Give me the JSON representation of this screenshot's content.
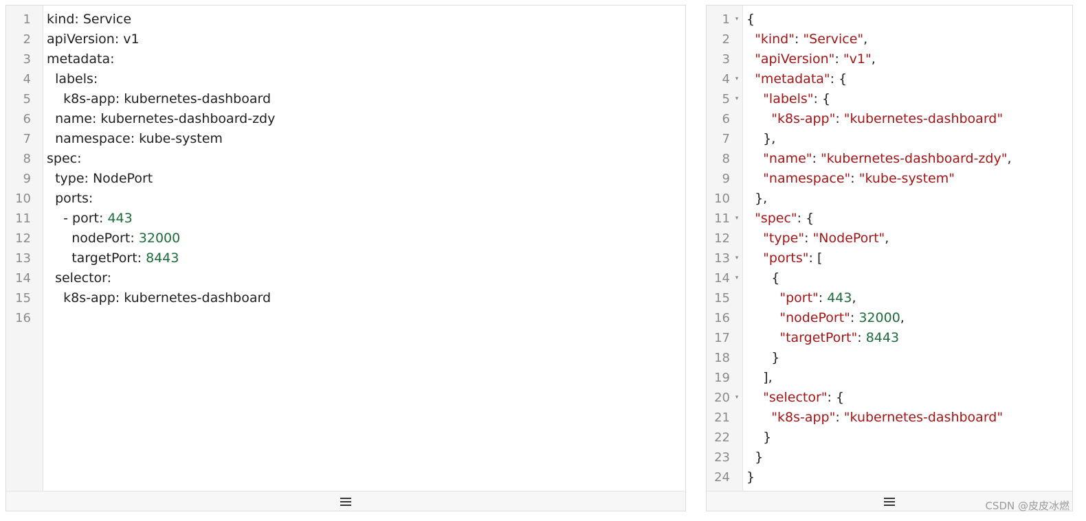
{
  "left_editor": {
    "lines": [
      {
        "n": "1",
        "tokens": [
          {
            "t": "kind: Service",
            "c": "p"
          }
        ]
      },
      {
        "n": "2",
        "tokens": [
          {
            "t": "apiVersion: v1",
            "c": "p"
          }
        ]
      },
      {
        "n": "3",
        "tokens": [
          {
            "t": "metadata:",
            "c": "p"
          }
        ]
      },
      {
        "n": "4",
        "tokens": [
          {
            "t": "  labels:",
            "c": "p"
          }
        ]
      },
      {
        "n": "5",
        "tokens": [
          {
            "t": "    k8s-app: kubernetes-dashboard",
            "c": "p"
          }
        ]
      },
      {
        "n": "6",
        "tokens": [
          {
            "t": "  name: kubernetes-dashboard-zdy",
            "c": "p"
          }
        ]
      },
      {
        "n": "7",
        "tokens": [
          {
            "t": "  namespace: kube-system",
            "c": "p"
          }
        ]
      },
      {
        "n": "8",
        "tokens": [
          {
            "t": "spec:",
            "c": "p"
          }
        ]
      },
      {
        "n": "9",
        "tokens": [
          {
            "t": "  type: NodePort",
            "c": "p"
          }
        ]
      },
      {
        "n": "10",
        "tokens": [
          {
            "t": "  ports:",
            "c": "p"
          }
        ]
      },
      {
        "n": "11",
        "tokens": [
          {
            "t": "    - port: ",
            "c": "p"
          },
          {
            "t": "443",
            "c": "n"
          }
        ]
      },
      {
        "n": "12",
        "tokens": [
          {
            "t": "      nodePort: ",
            "c": "p"
          },
          {
            "t": "32000",
            "c": "n"
          }
        ]
      },
      {
        "n": "13",
        "tokens": [
          {
            "t": "      targetPort: ",
            "c": "p"
          },
          {
            "t": "8443",
            "c": "n"
          }
        ]
      },
      {
        "n": "14",
        "tokens": [
          {
            "t": "  selector:",
            "c": "p"
          }
        ]
      },
      {
        "n": "15",
        "tokens": [
          {
            "t": "    k8s-app: kubernetes-dashboard",
            "c": "p"
          }
        ]
      },
      {
        "n": "16",
        "tokens": []
      }
    ],
    "footer_icon": "menu-icon"
  },
  "right_editor": {
    "lines": [
      {
        "n": "1",
        "fold": true,
        "tokens": [
          {
            "t": "{",
            "c": "p"
          }
        ]
      },
      {
        "n": "2",
        "tokens": [
          {
            "t": "  ",
            "c": "p"
          },
          {
            "t": "\"kind\"",
            "c": "k"
          },
          {
            "t": ": ",
            "c": "p"
          },
          {
            "t": "\"Service\"",
            "c": "s"
          },
          {
            "t": ",",
            "c": "p"
          }
        ]
      },
      {
        "n": "3",
        "tokens": [
          {
            "t": "  ",
            "c": "p"
          },
          {
            "t": "\"apiVersion\"",
            "c": "k"
          },
          {
            "t": ": ",
            "c": "p"
          },
          {
            "t": "\"v1\"",
            "c": "s"
          },
          {
            "t": ",",
            "c": "p"
          }
        ]
      },
      {
        "n": "4",
        "fold": true,
        "tokens": [
          {
            "t": "  ",
            "c": "p"
          },
          {
            "t": "\"metadata\"",
            "c": "k"
          },
          {
            "t": ": {",
            "c": "p"
          }
        ]
      },
      {
        "n": "5",
        "fold": true,
        "tokens": [
          {
            "t": "    ",
            "c": "p"
          },
          {
            "t": "\"labels\"",
            "c": "k"
          },
          {
            "t": ": {",
            "c": "p"
          }
        ]
      },
      {
        "n": "6",
        "tokens": [
          {
            "t": "      ",
            "c": "p"
          },
          {
            "t": "\"k8s-app\"",
            "c": "k"
          },
          {
            "t": ": ",
            "c": "p"
          },
          {
            "t": "\"kubernetes-dashboard\"",
            "c": "s"
          }
        ]
      },
      {
        "n": "7",
        "tokens": [
          {
            "t": "    },",
            "c": "p"
          }
        ]
      },
      {
        "n": "8",
        "tokens": [
          {
            "t": "    ",
            "c": "p"
          },
          {
            "t": "\"name\"",
            "c": "k"
          },
          {
            "t": ": ",
            "c": "p"
          },
          {
            "t": "\"kubernetes-dashboard-zdy\"",
            "c": "s"
          },
          {
            "t": ",",
            "c": "p"
          }
        ]
      },
      {
        "n": "9",
        "tokens": [
          {
            "t": "    ",
            "c": "p"
          },
          {
            "t": "\"namespace\"",
            "c": "k"
          },
          {
            "t": ": ",
            "c": "p"
          },
          {
            "t": "\"kube-system\"",
            "c": "s"
          }
        ]
      },
      {
        "n": "10",
        "tokens": [
          {
            "t": "  },",
            "c": "p"
          }
        ]
      },
      {
        "n": "11",
        "fold": true,
        "tokens": [
          {
            "t": "  ",
            "c": "p"
          },
          {
            "t": "\"spec\"",
            "c": "k"
          },
          {
            "t": ": {",
            "c": "p"
          }
        ]
      },
      {
        "n": "12",
        "tokens": [
          {
            "t": "    ",
            "c": "p"
          },
          {
            "t": "\"type\"",
            "c": "k"
          },
          {
            "t": ": ",
            "c": "p"
          },
          {
            "t": "\"NodePort\"",
            "c": "s"
          },
          {
            "t": ",",
            "c": "p"
          }
        ]
      },
      {
        "n": "13",
        "fold": true,
        "tokens": [
          {
            "t": "    ",
            "c": "p"
          },
          {
            "t": "\"ports\"",
            "c": "k"
          },
          {
            "t": ": [",
            "c": "p"
          }
        ]
      },
      {
        "n": "14",
        "fold": true,
        "tokens": [
          {
            "t": "      {",
            "c": "p"
          }
        ]
      },
      {
        "n": "15",
        "tokens": [
          {
            "t": "        ",
            "c": "p"
          },
          {
            "t": "\"port\"",
            "c": "k"
          },
          {
            "t": ": ",
            "c": "p"
          },
          {
            "t": "443",
            "c": "n"
          },
          {
            "t": ",",
            "c": "p"
          }
        ]
      },
      {
        "n": "16",
        "tokens": [
          {
            "t": "        ",
            "c": "p"
          },
          {
            "t": "\"nodePort\"",
            "c": "k"
          },
          {
            "t": ": ",
            "c": "p"
          },
          {
            "t": "32000",
            "c": "n"
          },
          {
            "t": ",",
            "c": "p"
          }
        ]
      },
      {
        "n": "17",
        "tokens": [
          {
            "t": "        ",
            "c": "p"
          },
          {
            "t": "\"targetPort\"",
            "c": "k"
          },
          {
            "t": ": ",
            "c": "p"
          },
          {
            "t": "8443",
            "c": "n"
          }
        ]
      },
      {
        "n": "18",
        "tokens": [
          {
            "t": "      }",
            "c": "p"
          }
        ]
      },
      {
        "n": "19",
        "tokens": [
          {
            "t": "    ],",
            "c": "p"
          }
        ]
      },
      {
        "n": "20",
        "fold": true,
        "tokens": [
          {
            "t": "    ",
            "c": "p"
          },
          {
            "t": "\"selector\"",
            "c": "k"
          },
          {
            "t": ": {",
            "c": "p"
          }
        ]
      },
      {
        "n": "21",
        "tokens": [
          {
            "t": "      ",
            "c": "p"
          },
          {
            "t": "\"k8s-app\"",
            "c": "k"
          },
          {
            "t": ": ",
            "c": "p"
          },
          {
            "t": "\"kubernetes-dashboard\"",
            "c": "s"
          }
        ]
      },
      {
        "n": "22",
        "tokens": [
          {
            "t": "    }",
            "c": "p"
          }
        ]
      },
      {
        "n": "23",
        "tokens": [
          {
            "t": "  }",
            "c": "p"
          }
        ]
      },
      {
        "n": "24",
        "tokens": [
          {
            "t": "}",
            "c": "p"
          }
        ]
      }
    ],
    "footer_icon": "menu-icon",
    "fold_icon": "▾"
  },
  "watermark": "CSDN @皮皮冰燃",
  "colors": {
    "key": "#a31515",
    "string": "#a31515",
    "number": "#1b6b3a",
    "text": "#1e1e1e",
    "line_number": "#8a8a8a"
  }
}
